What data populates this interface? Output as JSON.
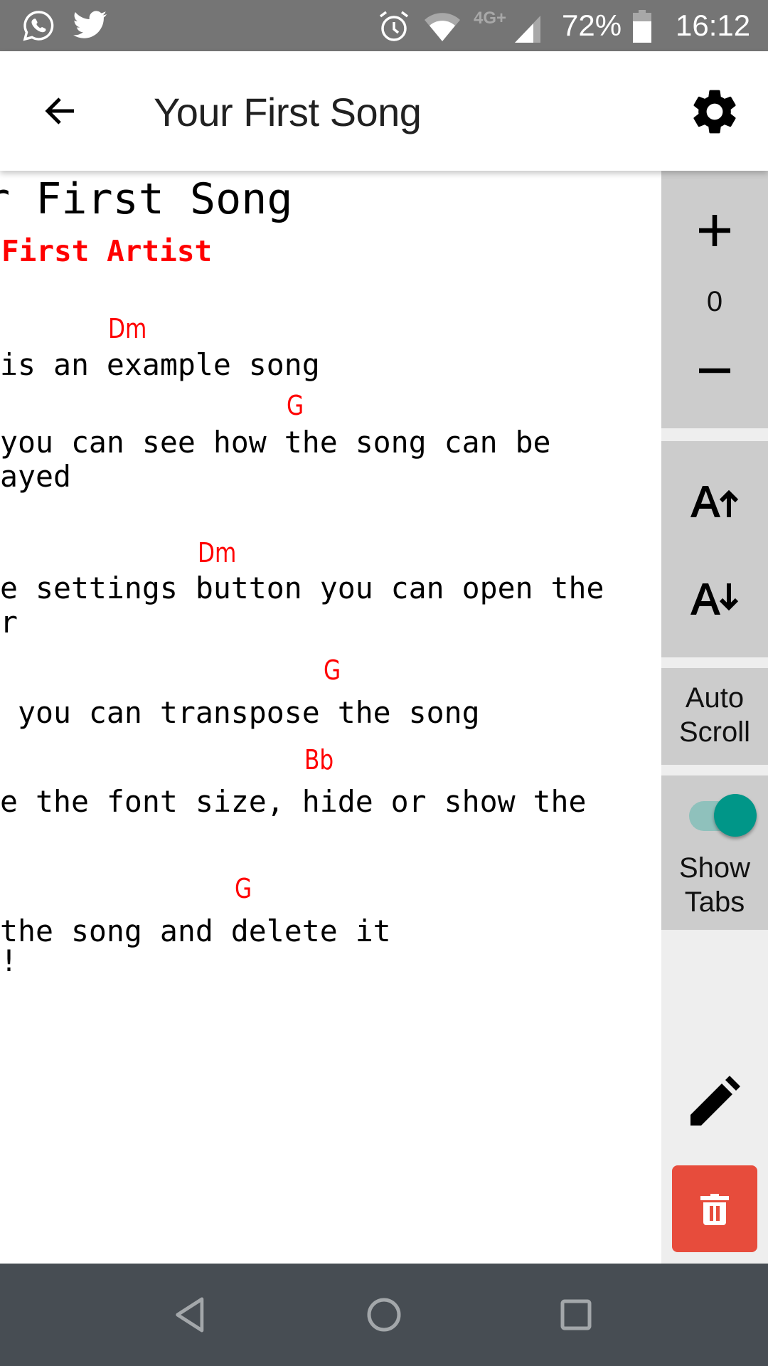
{
  "status_bar": {
    "left_icons": [
      "whatsapp-icon",
      "twitter-icon"
    ],
    "right_icons": [
      "alarm-icon",
      "wifi-icon",
      "signal-icon",
      "battery-icon"
    ],
    "network": "4G+",
    "battery": "72%",
    "time": "16:12"
  },
  "app_bar": {
    "title": "Your First Song",
    "back_icon": "arrow-back-icon",
    "settings_icon": "gear-icon"
  },
  "song": {
    "title": "r First Song",
    "artist": "First Artist",
    "blocks": [
      {
        "chord": "Dm",
        "lyrics": [
          "is an example song"
        ]
      },
      {
        "chord": "G",
        "lyrics": [
          "you can see how the song can be",
          "ayed"
        ]
      },
      {
        "chord": "Dm",
        "lyrics": [
          "e settings button you can open the",
          "r"
        ]
      },
      {
        "chord": "G",
        "lyrics": [
          " you can transpose the song"
        ]
      },
      {
        "chord": "Bb",
        "lyrics": [
          "e the font size, hide or show the"
        ]
      },
      {
        "chord": "G",
        "lyrics": [
          "the song and delete it"
        ]
      }
    ],
    "ending": "!"
  },
  "sidebar": {
    "transpose": {
      "up_icon": "plus-icon",
      "value": "0",
      "down_icon": "minus-icon"
    },
    "font_size": {
      "increase_icon": "font-increase-icon",
      "decrease_icon": "font-decrease-icon"
    },
    "auto_scroll": {
      "label_line1": "Auto",
      "label_line2": "Scroll"
    },
    "show_tabs": {
      "label_line1": "Show",
      "label_line2": "Tabs",
      "enabled": true
    },
    "edit_icon": "pencil-icon",
    "delete_icon": "trash-icon"
  },
  "colors": {
    "chord": "#ff0000",
    "toggle_on": "#009688",
    "toggle_track": "#8fc1bc",
    "delete": "#e74c3c",
    "panel": "#cccccc",
    "sidebar": "#eeeeee"
  },
  "nav_bar": {
    "buttons": [
      "back",
      "home",
      "recents"
    ]
  }
}
